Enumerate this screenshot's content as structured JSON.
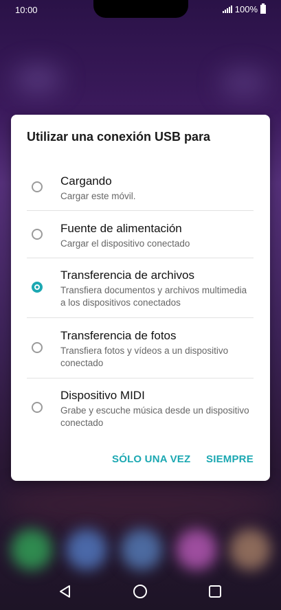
{
  "status_bar": {
    "time": "10:00",
    "battery": "100%"
  },
  "dialog": {
    "title": "Utilizar una conexión USB para",
    "options": [
      {
        "label": "Cargando",
        "description": "Cargar este móvil.",
        "selected": false
      },
      {
        "label": "Fuente de alimentación",
        "description": "Cargar el dispositivo conectado",
        "selected": false
      },
      {
        "label": "Transferencia de archivos",
        "description": "Transfiera documentos y archivos multimedia a los dispositivos conectados",
        "selected": true
      },
      {
        "label": "Transferencia de fotos",
        "description": "Transfiera fotos y vídeos a un dispositivo conectado",
        "selected": false
      },
      {
        "label": "Dispositivo MIDI",
        "description": "Grabe y escuche música desde un dispositivo conectado",
        "selected": false
      }
    ],
    "buttons": {
      "once": "SÓLO UNA VEZ",
      "always": "SIEMPRE"
    }
  },
  "colors": {
    "accent": "#1ca8b2",
    "radio_unchecked": "#9a9a9a"
  },
  "navigation": {
    "back": "back-icon",
    "home": "home-icon",
    "recents": "recents-icon"
  }
}
